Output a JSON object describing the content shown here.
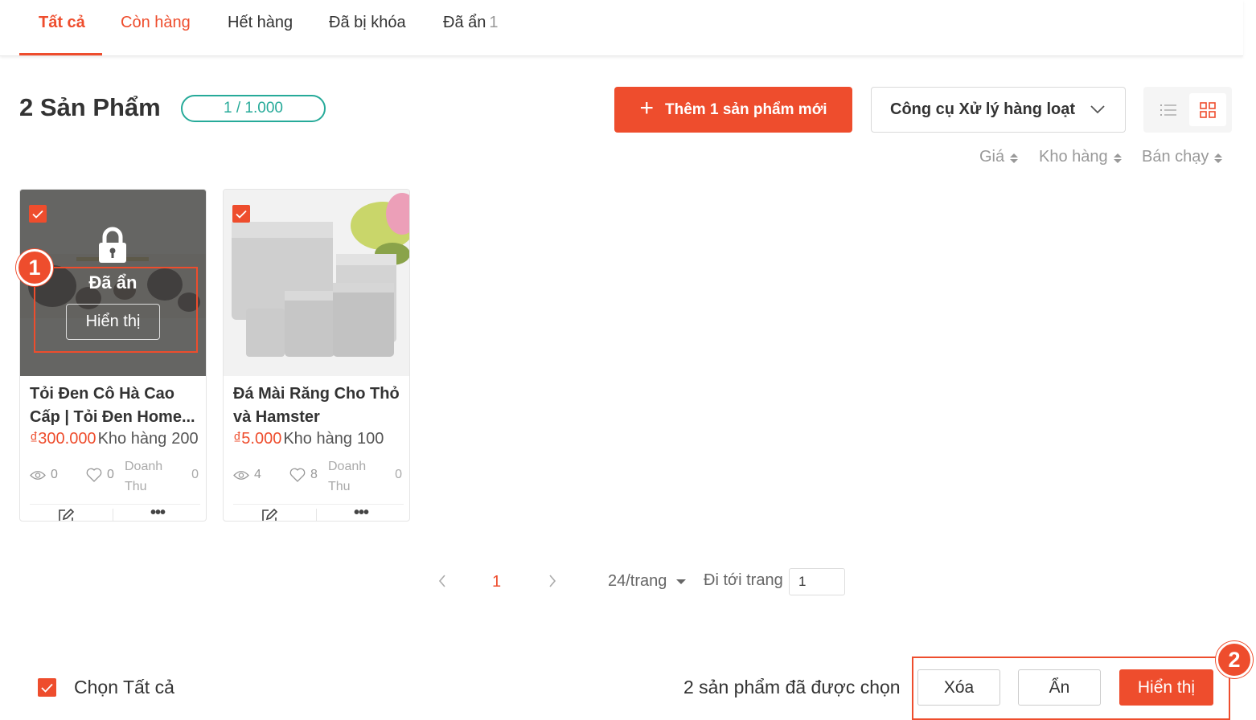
{
  "tabs": [
    {
      "label": "Tất cả",
      "count": ""
    },
    {
      "label": "Còn hàng",
      "count": ""
    },
    {
      "label": "Hết hàng",
      "count": ""
    },
    {
      "label": "Đã bị khóa",
      "count": ""
    },
    {
      "label": "Đã ẩn",
      "count": "1"
    }
  ],
  "header": {
    "title": "2 Sản Phẩm",
    "quota": "1 / 1.000",
    "add_button": "Thêm 1 sản phẩm mới",
    "bulk_tools": "Công cụ Xử lý hàng loạt"
  },
  "sort": {
    "price": "Giá",
    "stock": "Kho hàng",
    "best_selling": "Bán chạy"
  },
  "products": [
    {
      "name": "Tỏi Đen Cô Hà Cao Cấp | Tỏi Đen Home...",
      "price": "₫300.000",
      "stock_label": "Kho hàng",
      "stock": "200",
      "views": "0",
      "likes": "0",
      "revenue_label": "Doanh Thu",
      "revenue": "0",
      "hidden_label": "Đã ẩn",
      "show_button": "Hiển thị"
    },
    {
      "name": "Đá Mài Răng Cho Thỏ và Hamster",
      "price": "₫5.000",
      "stock_label": "Kho hàng",
      "stock": "100",
      "views": "4",
      "likes": "8",
      "revenue_label": "Doanh Thu",
      "revenue": "0"
    }
  ],
  "pagination": {
    "current_page": "1",
    "per_page": "24/trang",
    "goto_label": "Đi tới trang",
    "goto_value": "1"
  },
  "footer": {
    "select_all": "Chọn Tất cả",
    "selected_count": "2 sản phẩm đã được chọn",
    "delete": "Xóa",
    "hide": "Ẩn",
    "show": "Hiển thị"
  },
  "markers": [
    "1",
    "2"
  ],
  "colors": {
    "accent": "#ee4d2d",
    "teal": "#26aa99"
  }
}
